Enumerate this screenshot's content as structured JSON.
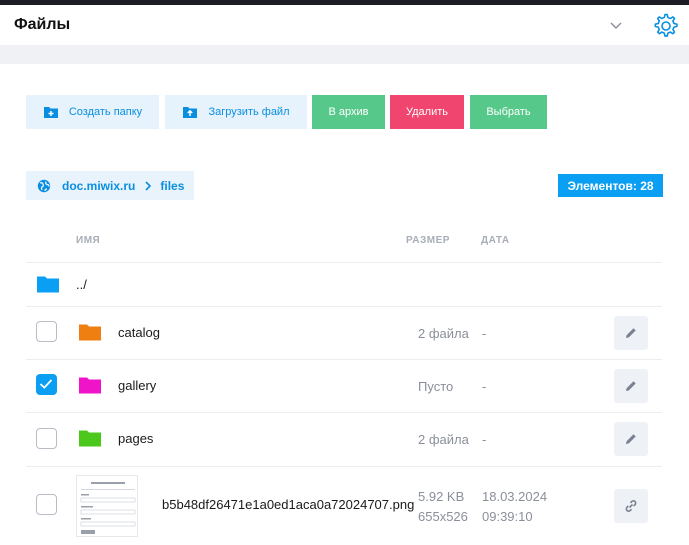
{
  "header": {
    "title": "Файлы",
    "chevron_icon": "chevron-down-icon",
    "settings_icon": "gear-icon"
  },
  "toolbar": {
    "create_folder": "Создать папку",
    "upload_file": "Загрузить файл",
    "archive": "В архив",
    "delete": "Удалить",
    "select": "Выбрать"
  },
  "breadcrumb": {
    "root": "doc.miwix.ru",
    "current": "files"
  },
  "count_badge": "Элементов: 28",
  "table": {
    "headers": {
      "name": "ИМЯ",
      "size": "РАЗМЕР",
      "date": "ДАТА"
    },
    "parent_dir": "../",
    "rows": [
      {
        "name": "catalog",
        "size": "2 файла",
        "date": "-",
        "checked": false,
        "folder_color": "#f07f12"
      },
      {
        "name": "gallery",
        "size": "Пусто",
        "date": "-",
        "checked": true,
        "folder_color": "#f014c8"
      },
      {
        "name": "pages",
        "size": "2 файла",
        "date": "-",
        "checked": false,
        "folder_color": "#4cc81c"
      },
      {
        "name": "b5b48df26471e1a0ed1aca0a72024707.png",
        "size": "5.92 KB",
        "dimensions": "655x526",
        "date": "18.03.2024",
        "time": "09:39:10",
        "checked": false
      }
    ]
  },
  "colors": {
    "accent": "#0a9ff2",
    "green": "#56c98a",
    "red": "#f0456e",
    "parent_folder": "#0a9ff2"
  }
}
